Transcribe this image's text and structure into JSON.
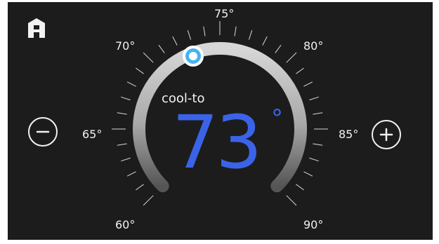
{
  "thermostat": {
    "mode": "cool-to",
    "setpoint": "73",
    "unit_symbol": "°",
    "setpoint_value": 73,
    "range_min": 60,
    "range_max": 90
  },
  "scale_labels": {
    "t60": "60°",
    "t65": "65°",
    "t70": "70°",
    "t75": "75°",
    "t80": "80°",
    "t85": "85°",
    "t90": "90°"
  },
  "icons": {
    "home": "home-icon",
    "minus": "minus-icon",
    "plus": "plus-icon"
  },
  "colors": {
    "background": "#1c1c1c",
    "setpoint": "#3a63e8",
    "thumb_ring": "#47b3f0",
    "text": "#f2f2f2"
  }
}
